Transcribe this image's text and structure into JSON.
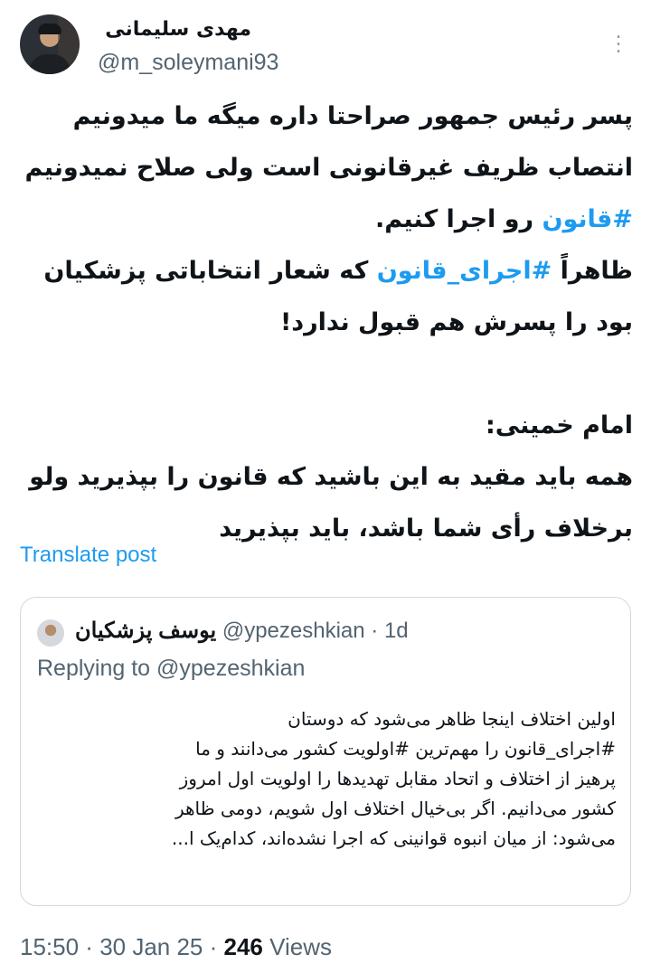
{
  "author": {
    "display_name": "مهدی سلیمانی",
    "username": "@m_soleymani93"
  },
  "tweet": {
    "line1_text": "پسر رئیس جمهور صراحتا داره میگه ما میدونیم",
    "line2_text": "انتصاب ظریف غیرقانونی است ولی صلاح نمیدونیم",
    "line3_hashtag": "#قانون",
    "line3_text": " رو اجرا کنیم.",
    "line4_prefix": "ظاهراً ",
    "line4_hashtag": "#اجرای_قانون",
    "line4_text": " که شعار انتخاباتی پزشکیان",
    "line5_text": "بود را پسرش هم قبول ندارد!",
    "line6_text": "امام خمینی:",
    "line7_text": "همه باید مقید به این باشید که قانون را بپذیرید ولو",
    "line8_text": "برخلاف رأی شما باشد، باید بپذیرید"
  },
  "translate_label": "Translate post",
  "quote": {
    "display_name": "یوسف پزشکیان",
    "handle": "@ypezeshkian",
    "time": " · 1d",
    "replying_to": "Replying to @ypezeshkian",
    "lines": [
      "اولین اختلاف اینجا ظاهر می‌شود که دوستان",
      "#اجرای_قانون را مهم‌ترین #اولویت کشور می‌دانند و ما",
      "پرهیز از اختلاف و اتحاد مقابل تهدیدها را اولویت اول امروز",
      "کشور می‌دانیم. اگر بی‌خیال اختلاف اول شویم، دومی ظاهر",
      "می‌شود: از میان انبوه قوانینی که اجرا نشده‌اند، کدام‌یک ا..."
    ]
  },
  "meta": {
    "time": "15:50",
    "date": "30 Jan 25",
    "views_count": "246",
    "views_label": "Views"
  }
}
